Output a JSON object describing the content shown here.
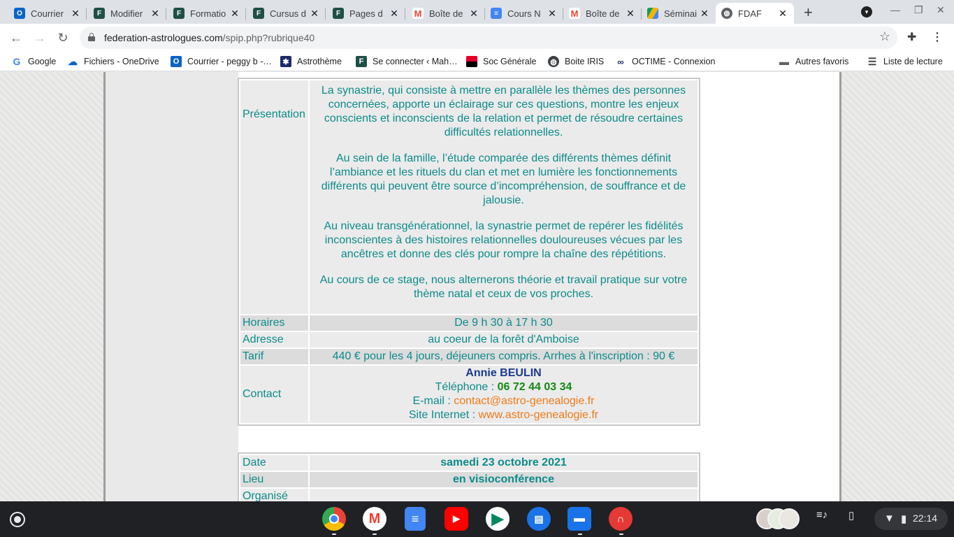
{
  "tabs": [
    {
      "title": "Courrier",
      "icon": "outlook-icon"
    },
    {
      "title": "Modifier",
      "icon": "fdaf-logo-icon"
    },
    {
      "title": "Formatio",
      "icon": "fdaf-logo-icon"
    },
    {
      "title": "Cursus d",
      "icon": "fdaf-logo-icon"
    },
    {
      "title": "Pages d",
      "icon": "fdaf-logo-icon"
    },
    {
      "title": "Boîte de",
      "icon": "gmail-icon"
    },
    {
      "title": "Cours N",
      "icon": "google-docs-icon"
    },
    {
      "title": "Boîte de",
      "icon": "gmail-icon"
    },
    {
      "title": "Séminai",
      "icon": "google-drive-icon"
    },
    {
      "title": "FDAF",
      "icon": "globe-icon"
    }
  ],
  "address_bar": {
    "domain": "federation-astrologues.com",
    "path": "/spip.php?rubrique40"
  },
  "bookmarks": [
    {
      "label": "Google",
      "icon": "google-icon"
    },
    {
      "label": "Fichiers - OneDrive",
      "icon": "onedrive-icon"
    },
    {
      "label": "Courrier - peggy b -…",
      "icon": "outlook-icon"
    },
    {
      "label": "Astrothème",
      "icon": "astrotheme-icon"
    },
    {
      "label": "Se connecter ‹ Mah…",
      "icon": "fdaf-logo-icon"
    },
    {
      "label": "Soc Générale",
      "icon": "socgen-icon"
    },
    {
      "label": "Boite IRIS",
      "icon": "globe-icon"
    },
    {
      "label": "OCTIME - Connexion",
      "icon": "octime-icon"
    }
  ],
  "bookmarks_right": {
    "other": "Autres favoris",
    "reading_list": "Liste de lecture"
  },
  "event1": {
    "presentation_label": "Présentation",
    "presentation_paragraphs": [
      "La synastrie, qui consiste à mettre en parallèle les thèmes des personnes concernées, apporte un éclairage sur ces questions, montre les enjeux conscients et inconscients de la relation et permet de résoudre certaines difficultés relationnelles.",
      "Au sein de la famille, l’étude comparée des différents thèmes définit l’ambiance et les rituels du clan et met en lumière les fonctionnements différents qui peuvent être source d’incompréhension, de souffrance et de jalousie.",
      "Au niveau transgénérationnel, la synastrie permet de repérer les fidélités inconscientes à des histoires relationnelles douloureuses vécues par les ancêtres et donne des clés pour rompre la chaîne des répétitions.",
      "Au cours de ce stage, nous alternerons théorie et travail pratique sur votre thème natal et ceux de vos proches."
    ],
    "horaires_label": "Horaires",
    "horaires": "De 9 h 30 à 17 h 30",
    "adresse_label": "Adresse",
    "adresse": "au coeur de la forêt d'Amboise",
    "tarif_label": "Tarif",
    "tarif": "440 € pour les 4 jours, déjeuners compris. Arrhes à l'inscription : 90 €",
    "contact_label": "Contact",
    "contact_name": "Annie BEULIN",
    "phone_prefix": "Téléphone : ",
    "phone": "06 72 44 03 34",
    "email_prefix": "E-mail : ",
    "email": "contact@astro-genealogie.fr",
    "site_prefix": "Site Internet : ",
    "site": "www.astro-genealogie.fr"
  },
  "event2": {
    "date_label": "Date",
    "date": "samedi 23 octobre 2021",
    "lieu_label": "Lieu",
    "lieu": "en visioconférence",
    "organise_label": "Organisé"
  },
  "shelf": {
    "apps": [
      "chrome-icon",
      "gmail-icon",
      "google-docs-icon",
      "youtube-icon",
      "play-store-icon",
      "messages-icon",
      "files-icon",
      "headphones-icon"
    ],
    "time": "22:14"
  },
  "colors": {
    "teal_text": "#0d8a8a",
    "contact_name": "#1a3a8f",
    "phone": "#138a13",
    "link": "#ee7a19"
  }
}
